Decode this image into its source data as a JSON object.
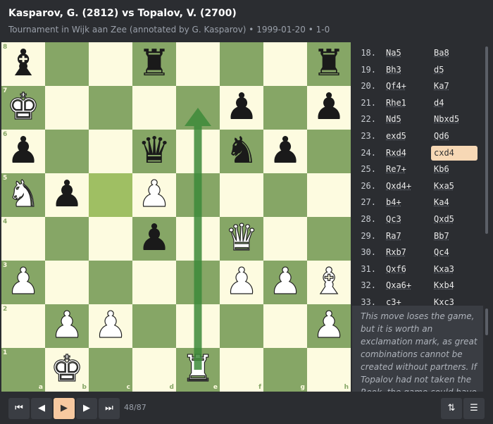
{
  "header": {
    "title": "Kasparov, G. (2812) vs Topalov, V. (2700)",
    "subtitle": "Tournament in Wijk aan Zee (annotated by G. Kasparov) • 1999-01-20 • 1-0"
  },
  "colors": {
    "light": "#fdfbe0",
    "dark": "#86a666",
    "highlight": "#9fbf63",
    "arrow": "#3d8a3a",
    "active_move": "#f7d8b5"
  },
  "board": {
    "ranks": [
      "8",
      "7",
      "6",
      "5",
      "4",
      "3",
      "2",
      "1"
    ],
    "files": [
      "a",
      "b",
      "c",
      "d",
      "e",
      "f",
      "g",
      "h"
    ],
    "pieces": [
      {
        "sq": "a8",
        "p": "B",
        "color": "b"
      },
      {
        "sq": "d8",
        "p": "R",
        "color": "b"
      },
      {
        "sq": "h8",
        "p": "R",
        "color": "b"
      },
      {
        "sq": "a7",
        "p": "K",
        "color": "w"
      },
      {
        "sq": "f7",
        "p": "P",
        "color": "b"
      },
      {
        "sq": "h7",
        "p": "P",
        "color": "b"
      },
      {
        "sq": "a6",
        "p": "P",
        "color": "b"
      },
      {
        "sq": "d6",
        "p": "Q",
        "color": "b"
      },
      {
        "sq": "f6",
        "p": "N",
        "color": "b"
      },
      {
        "sq": "g6",
        "p": "P",
        "color": "b"
      },
      {
        "sq": "a5",
        "p": "N",
        "color": "w"
      },
      {
        "sq": "b5",
        "p": "P",
        "color": "b"
      },
      {
        "sq": "d5",
        "p": "P",
        "color": "w"
      },
      {
        "sq": "d4",
        "p": "P",
        "color": "b"
      },
      {
        "sq": "f4",
        "p": "Q",
        "color": "w"
      },
      {
        "sq": "a3",
        "p": "P",
        "color": "w"
      },
      {
        "sq": "f3",
        "p": "P",
        "color": "w"
      },
      {
        "sq": "g3",
        "p": "P",
        "color": "w"
      },
      {
        "sq": "h3",
        "p": "B",
        "color": "w"
      },
      {
        "sq": "b2",
        "p": "P",
        "color": "w"
      },
      {
        "sq": "c2",
        "p": "P",
        "color": "w"
      },
      {
        "sq": "h2",
        "p": "P",
        "color": "w"
      },
      {
        "sq": "b1",
        "p": "K",
        "color": "w"
      },
      {
        "sq": "e1",
        "p": "R",
        "color": "w"
      }
    ],
    "highlighted": [
      "c5"
    ],
    "arrow": {
      "from": "e1",
      "to": "e7"
    }
  },
  "moves": [
    {
      "num": "18.",
      "w": "Na5",
      "b": "Ba8"
    },
    {
      "num": "19.",
      "w": "Bh3",
      "b": "d5"
    },
    {
      "num": "20.",
      "w": "Qf4+",
      "b": "Ka7"
    },
    {
      "num": "21.",
      "w": "Rhe1",
      "b": "d4"
    },
    {
      "num": "22.",
      "w": "Nd5",
      "b": "Nbxd5"
    },
    {
      "num": "23.",
      "w": "exd5",
      "b": "Qd6"
    },
    {
      "num": "24.",
      "w": "Rxd4",
      "b": "cxd4",
      "active": "b"
    },
    {
      "num": "25.",
      "w": "Re7+",
      "b": "Kb6"
    },
    {
      "num": "26.",
      "w": "Qxd4+",
      "b": "Kxa5"
    },
    {
      "num": "27.",
      "w": "b4+",
      "b": "Ka4"
    },
    {
      "num": "28.",
      "w": "Qc3",
      "b": "Qxd5"
    },
    {
      "num": "29.",
      "w": "Ra7",
      "b": "Bb7"
    },
    {
      "num": "30.",
      "w": "Rxb7",
      "b": "Qc4"
    },
    {
      "num": "31.",
      "w": "Qxf6",
      "b": "Kxa3"
    },
    {
      "num": "32.",
      "w": "Qxa6+",
      "b": "Kxb4"
    },
    {
      "num": "33.",
      "w": "c3+",
      "b": "Kxc3"
    }
  ],
  "comment": "This move loses the game, but it is worth an exclamation mark, as great combinations cannot be created without partners. If Topalov had not taken the Rook, the game could have finished in a draw:",
  "controls": {
    "first_icon": "⏮",
    "prev_icon": "◀",
    "play_icon": "▶",
    "next_icon": "▶",
    "last_icon": "⏭",
    "counter": "48/87",
    "flip_icon": "⇅",
    "menu_icon": "☰"
  }
}
